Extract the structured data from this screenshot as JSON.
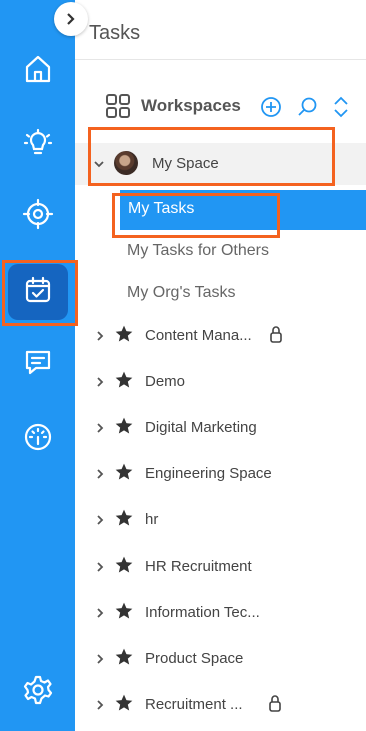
{
  "panel": {
    "title": "Tasks"
  },
  "rail": {
    "items": [
      {
        "icon": "home-icon",
        "active": false
      },
      {
        "icon": "lightbulb-icon",
        "active": false
      },
      {
        "icon": "target-icon",
        "active": false
      },
      {
        "icon": "calendar-check-icon",
        "active": true
      },
      {
        "icon": "chat-icon",
        "active": false
      },
      {
        "icon": "dashboard-gauge-icon",
        "active": false
      },
      {
        "icon": "settings-gear-icon",
        "active": false
      }
    ]
  },
  "workspaces": {
    "label": "Workspaces",
    "actions": [
      "add-icon",
      "search-icon",
      "expand-collapse-icon"
    ]
  },
  "my_space": {
    "label": "My Space",
    "items": [
      {
        "label": "My Tasks",
        "selected": true
      },
      {
        "label": "My Tasks for Others",
        "selected": false
      },
      {
        "label": "My Org's Tasks",
        "selected": false
      }
    ]
  },
  "spaces": [
    {
      "name": "Content Mana...",
      "locked": true
    },
    {
      "name": "Demo",
      "locked": false
    },
    {
      "name": "Digital Marketing",
      "locked": false
    },
    {
      "name": "Engineering Space",
      "locked": false
    },
    {
      "name": "hr",
      "locked": false
    },
    {
      "name": "HR Recruitment",
      "locked": false
    },
    {
      "name": "Information Tec...",
      "locked": false
    },
    {
      "name": "Product Space",
      "locked": false
    },
    {
      "name": "Recruitment ...",
      "locked": true
    }
  ],
  "colors": {
    "accent": "#2196f3",
    "highlight": "#f4621f",
    "rail_active": "#1565c0"
  }
}
